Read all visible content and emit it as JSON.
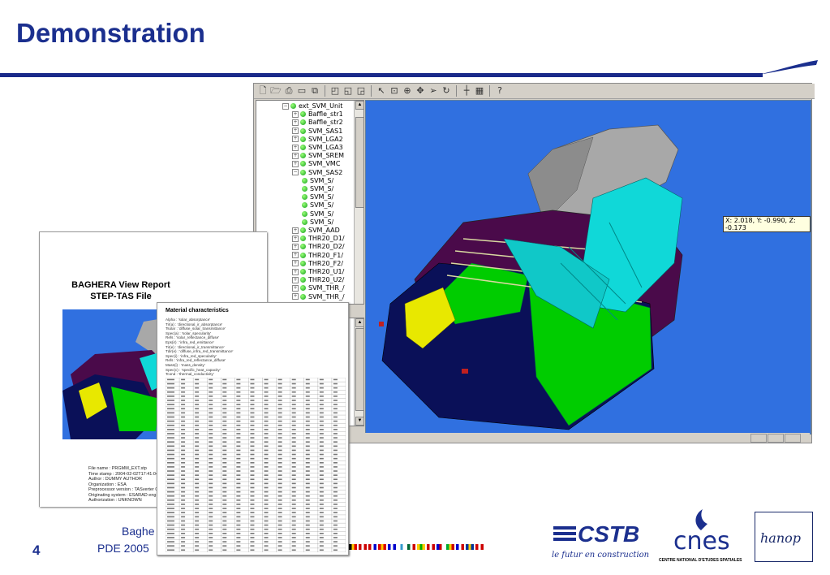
{
  "slide": {
    "title": "Demonstration",
    "page_number": "4",
    "footer_line1": "Baghe",
    "footer_line2": "PDE 2005"
  },
  "app": {
    "tree_nodes": [
      {
        "label": "ext_SVM_Unit",
        "indent": 0,
        "expander": "−"
      },
      {
        "label": "Baffle_str1",
        "indent": 1,
        "expander": "+"
      },
      {
        "label": "Baffle_str2",
        "indent": 1,
        "expander": "+"
      },
      {
        "label": "SVM_SAS1",
        "indent": 1,
        "expander": "+"
      },
      {
        "label": "SVM_LGA2",
        "indent": 1,
        "expander": "+"
      },
      {
        "label": "SVM_LGA3",
        "indent": 1,
        "expander": "+"
      },
      {
        "label": "SVM_SREM",
        "indent": 1,
        "expander": "+"
      },
      {
        "label": "SVM_VMC",
        "indent": 1,
        "expander": "+"
      },
      {
        "label": "SVM_SAS2",
        "indent": 1,
        "expander": "−"
      },
      {
        "label": "SVM_S/",
        "indent": 2,
        "expander": ""
      },
      {
        "label": "SVM_S/",
        "indent": 2,
        "expander": ""
      },
      {
        "label": "SVM_S/",
        "indent": 2,
        "expander": ""
      },
      {
        "label": "SVM_S/",
        "indent": 2,
        "expander": ""
      },
      {
        "label": "SVM_S/",
        "indent": 2,
        "expander": ""
      },
      {
        "label": "SVM_S/",
        "indent": 2,
        "expander": ""
      },
      {
        "label": "SVM_AAD",
        "indent": 1,
        "expander": "+"
      },
      {
        "label": "THR20_D1/",
        "indent": 1,
        "expander": "+"
      },
      {
        "label": "THR20_D2/",
        "indent": 1,
        "expander": "+"
      },
      {
        "label": "THR20_F1/",
        "indent": 1,
        "expander": "+"
      },
      {
        "label": "THR20_F2/",
        "indent": 1,
        "expander": "+"
      },
      {
        "label": "THR20_U1/",
        "indent": 1,
        "expander": "+"
      },
      {
        "label": "THR20_U2/",
        "indent": 1,
        "expander": "+"
      },
      {
        "label": "SVM_THR_/",
        "indent": 1,
        "expander": "+"
      },
      {
        "label": "SVM_THR_/",
        "indent": 1,
        "expander": "+"
      }
    ],
    "coordinate_readout": "X: 2.018, Y: -0.990, Z: -0.173"
  },
  "report": {
    "title_line1": "BAGHERA View Report",
    "title_line2": "STEP-TAS File",
    "info_lines": [
      "File name : PRGMM_EXT.stp",
      "Time stamp : 2004-02-02T17:41:04+0100",
      "Author : DUMMY AUTHOR",
      "Organization : ESA",
      "Preprocessor version : TASverter 0.1(04-02-",
      "Originating system : ESARAD eng.",
      "Authorization : UNKNOWN"
    ]
  },
  "material": {
    "title": "Material characteristics",
    "lines": [
      "Alpha : 'solar_absorptance'",
      "Tir(a) : 'directional_ir_absorptance'",
      "Tsolar : 'diffuse_solar_transmittance'",
      "Spec(a) : 'solar_specularity'",
      "Refs : 'solar_reflectance_diffuse'",
      "Eps(ir) : 'infra_red_emittance'",
      "Tir(e) : 'directional_ir_transmittance'",
      "Tdir(e) : 'diffuse_infra_red_transmittance'",
      "Spec(i) : 'infra_red_specularity'",
      "Refs : 'infra_red_reflectance_diffuse'",
      "Mass(i) : 'mass_density'",
      "Spec(c) : 'specific_heat_capacity'",
      "Tcond : 'thermal_conductivity'"
    ]
  },
  "colors": {
    "brand_blue": "#1b2f8e",
    "viewport_bg": "#3070e0",
    "model_green": "#00cc00",
    "model_navy": "#0a1058",
    "model_cyan": "#10d8d8",
    "model_purple": "#4a0a4a",
    "model_gray": "#a0a0a0",
    "model_yellow": "#e8e800"
  },
  "logos": {
    "cstb": "CSTB",
    "cstb_tagline": "le futur en construction",
    "cnes": "cnes",
    "cnes_tagline": "CENTRE NATIONAL D'ETUDES SPATIALES",
    "hanop": "hanop"
  }
}
